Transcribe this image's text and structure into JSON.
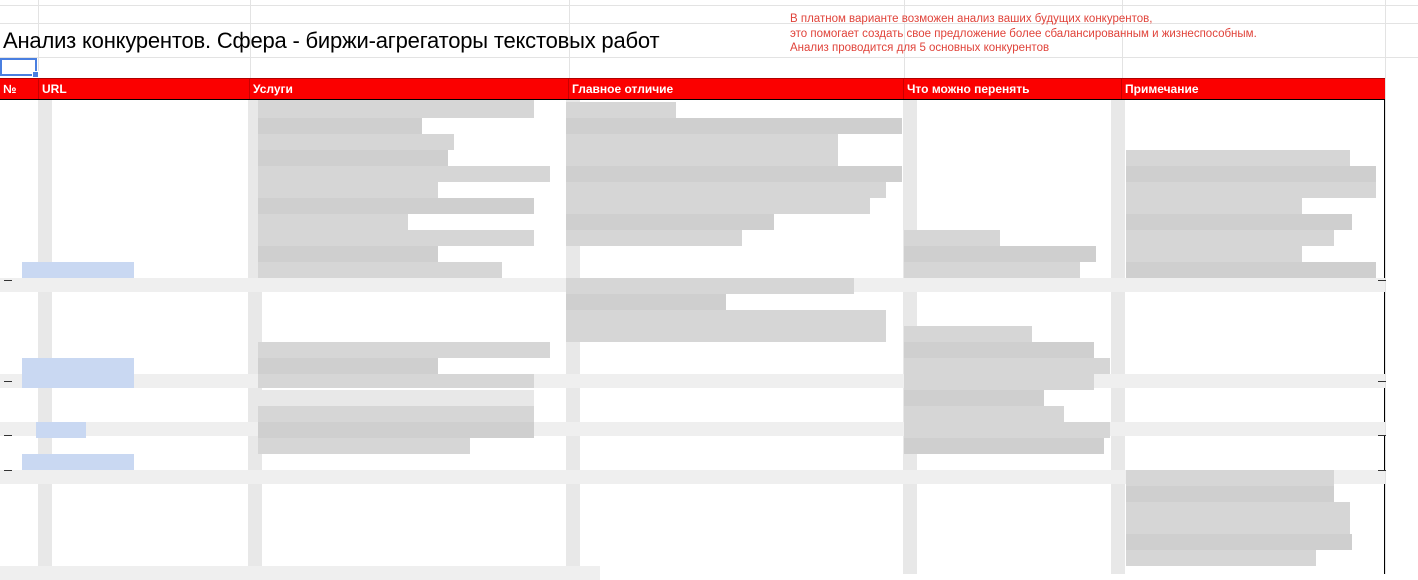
{
  "sheet": {
    "title": "Анализ конкурентов. Сфера - биржи-агрегаторы текстовых работ",
    "note_lines": [
      "В платном варианте возможен анализ ваших будущих конкурентов,",
      "это помогает создать свое предложение более сбалансированным и жизнеспособным.",
      "Анализ проводится для 5 основных конкурентов"
    ],
    "columns": [
      "№",
      "URL",
      "Услуги",
      "Главное отличие",
      "Что можно перенять",
      "Примечание"
    ],
    "header_color": "#fb0000",
    "note_color": "#e0433a"
  }
}
